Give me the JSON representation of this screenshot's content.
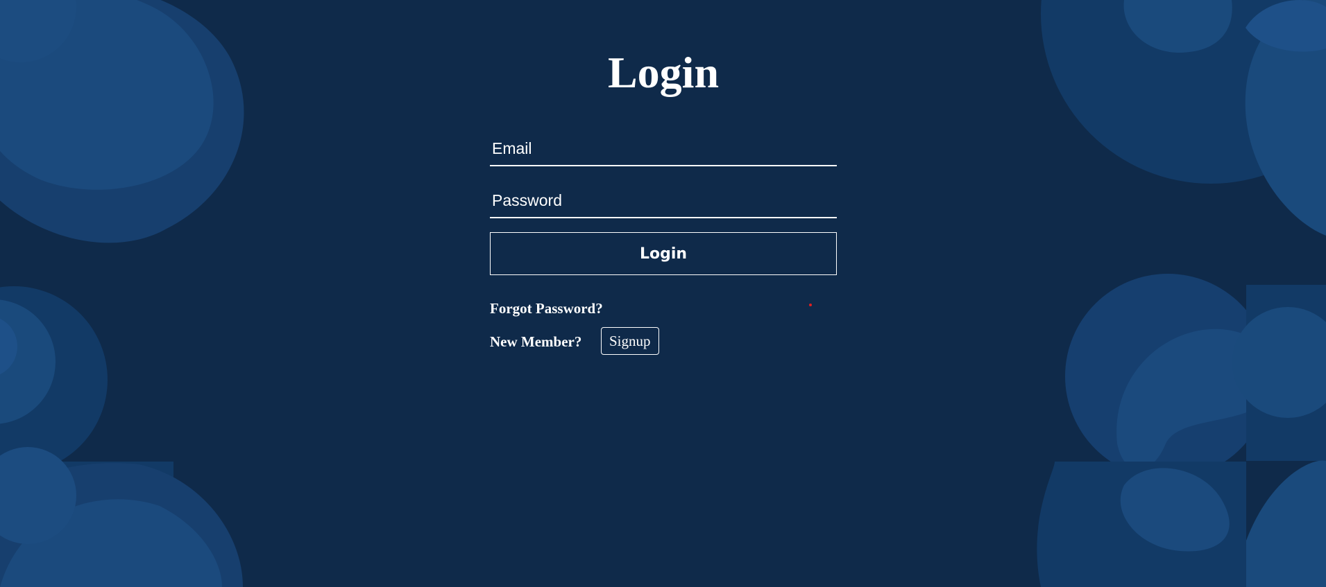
{
  "page": {
    "title": "Login"
  },
  "form": {
    "email_placeholder": "Email",
    "password_placeholder": "Password",
    "login_button": "Login"
  },
  "links": {
    "forgot_password": "Forgot Password?",
    "new_member": "New Member?",
    "signup_button": "Signup"
  },
  "colors": {
    "background": "#0f2a4a",
    "blob_dark": "#123a66",
    "blob_light": "#1a4a7c",
    "text": "#ffffff",
    "accent_dot": "#e02020"
  }
}
